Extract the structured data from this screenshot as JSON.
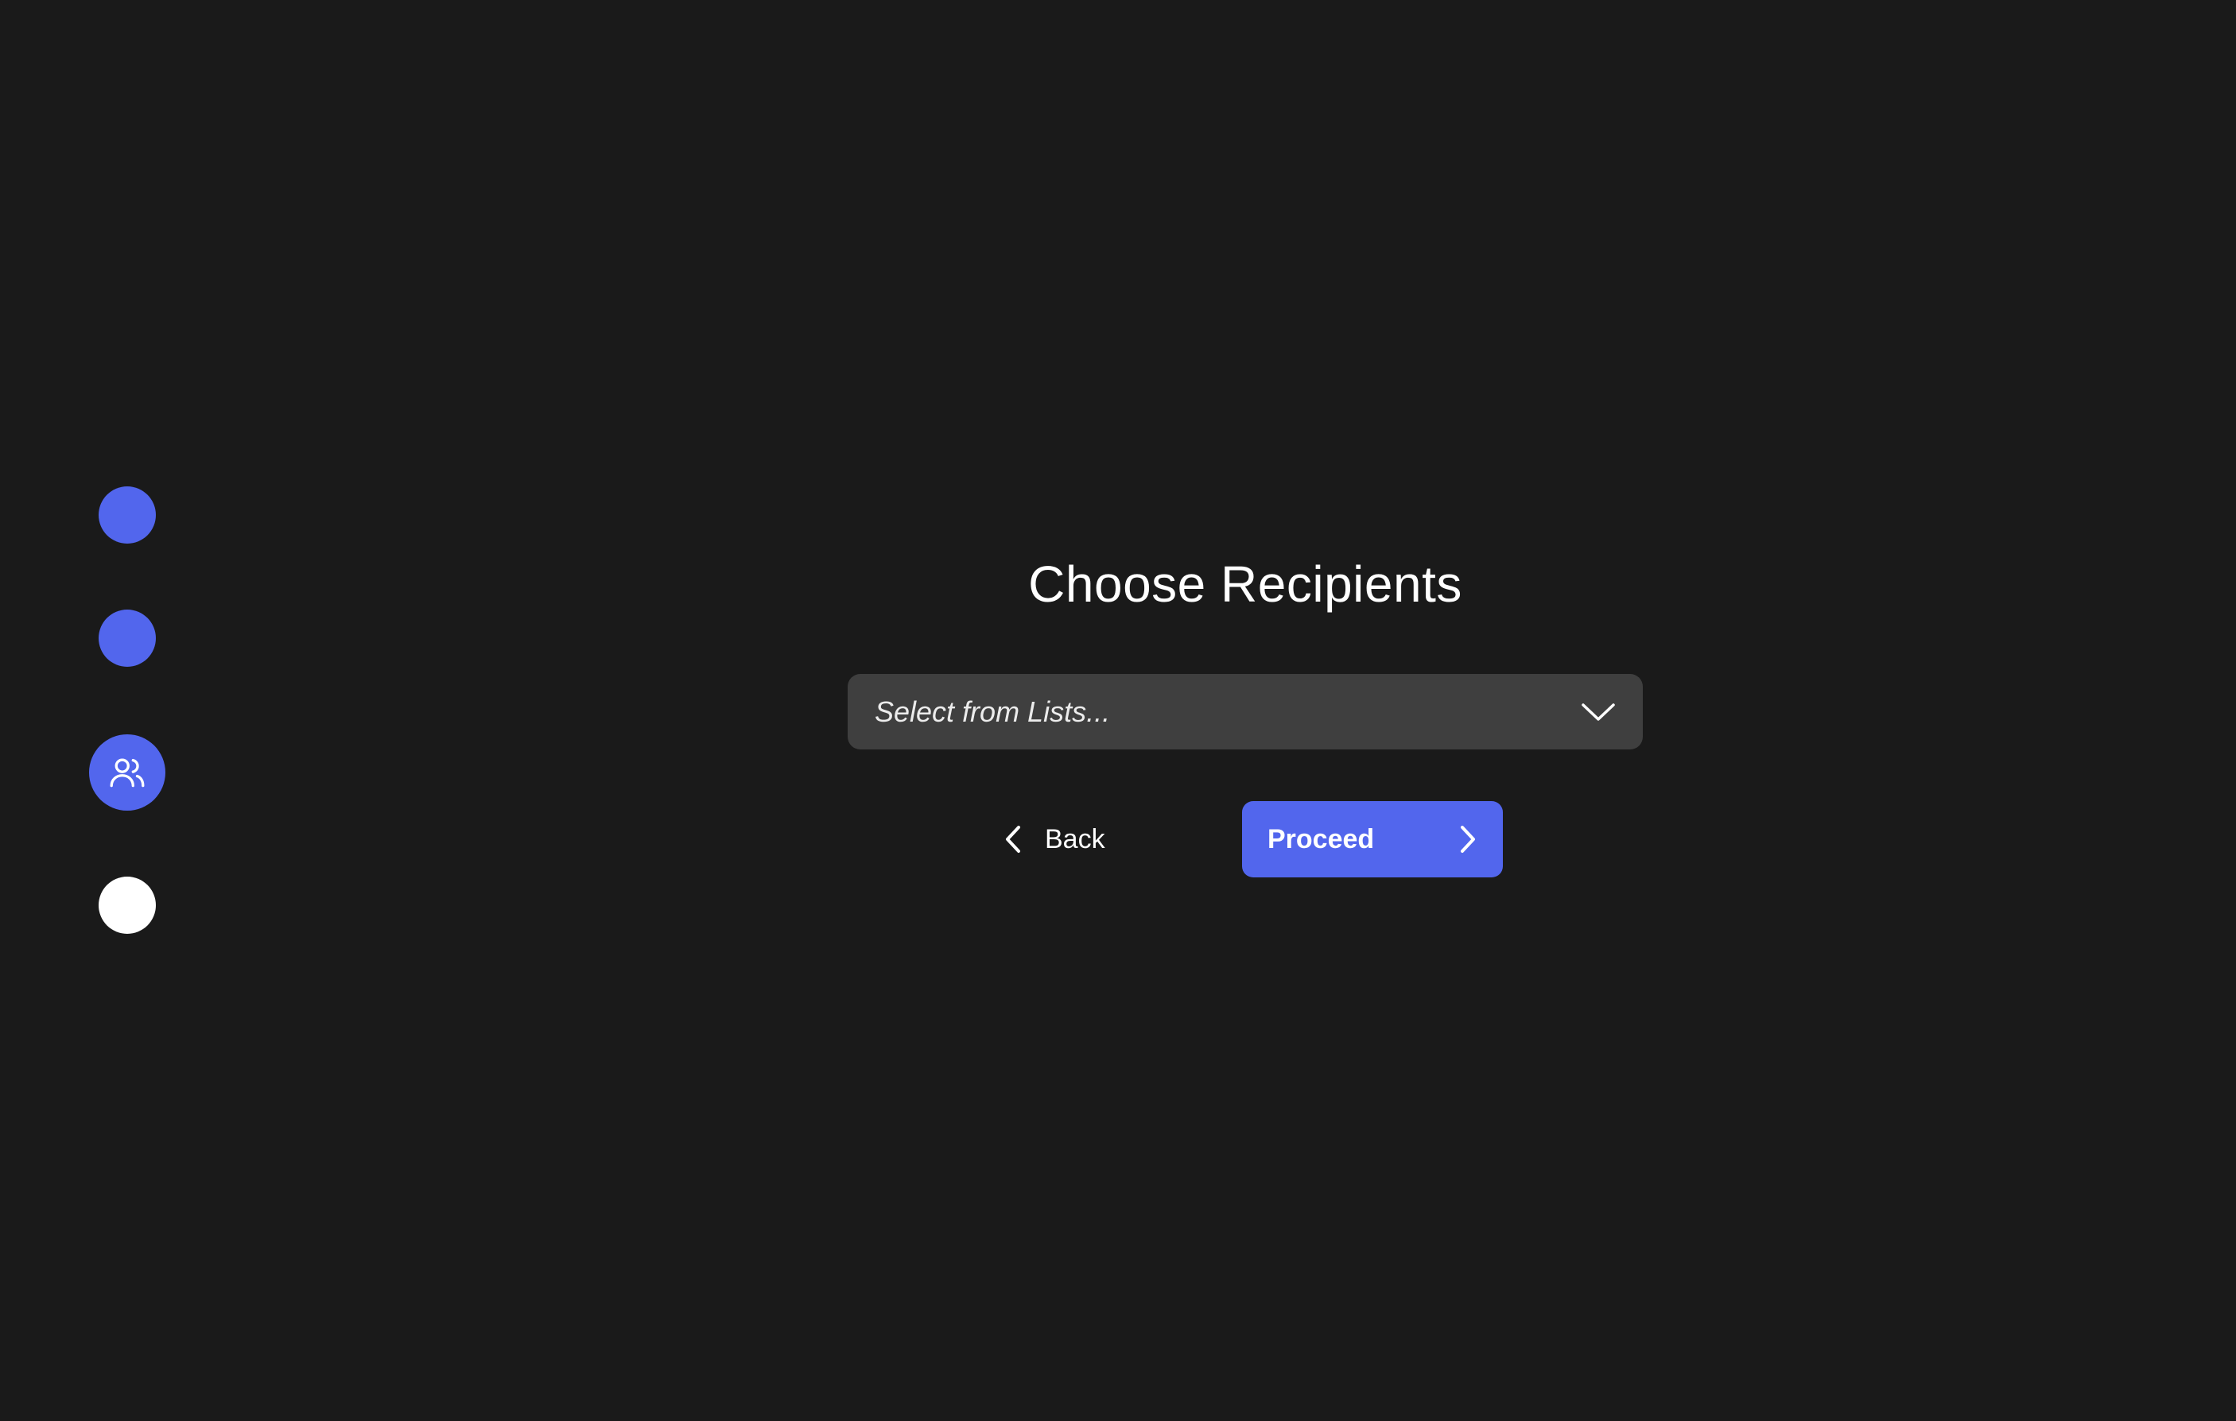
{
  "steps": [
    {
      "state": "completed",
      "color": "#5266ed"
    },
    {
      "state": "completed",
      "color": "#5266ed"
    },
    {
      "state": "current",
      "color": "#5266ed",
      "icon": "users-icon"
    },
    {
      "state": "upcoming",
      "color": "#ffffff"
    }
  ],
  "main": {
    "title": "Choose Recipients",
    "select": {
      "placeholder": "Select from Lists...",
      "icon": "chevron-down-icon"
    },
    "back_button": {
      "label": "Back",
      "icon": "chevron-left-icon"
    },
    "proceed_button": {
      "label": "Proceed",
      "icon": "chevron-right-icon"
    }
  },
  "colors": {
    "background": "#1a1a1a",
    "accent": "#5266ed",
    "input_background": "#3f3f3f",
    "text": "#ffffff"
  }
}
